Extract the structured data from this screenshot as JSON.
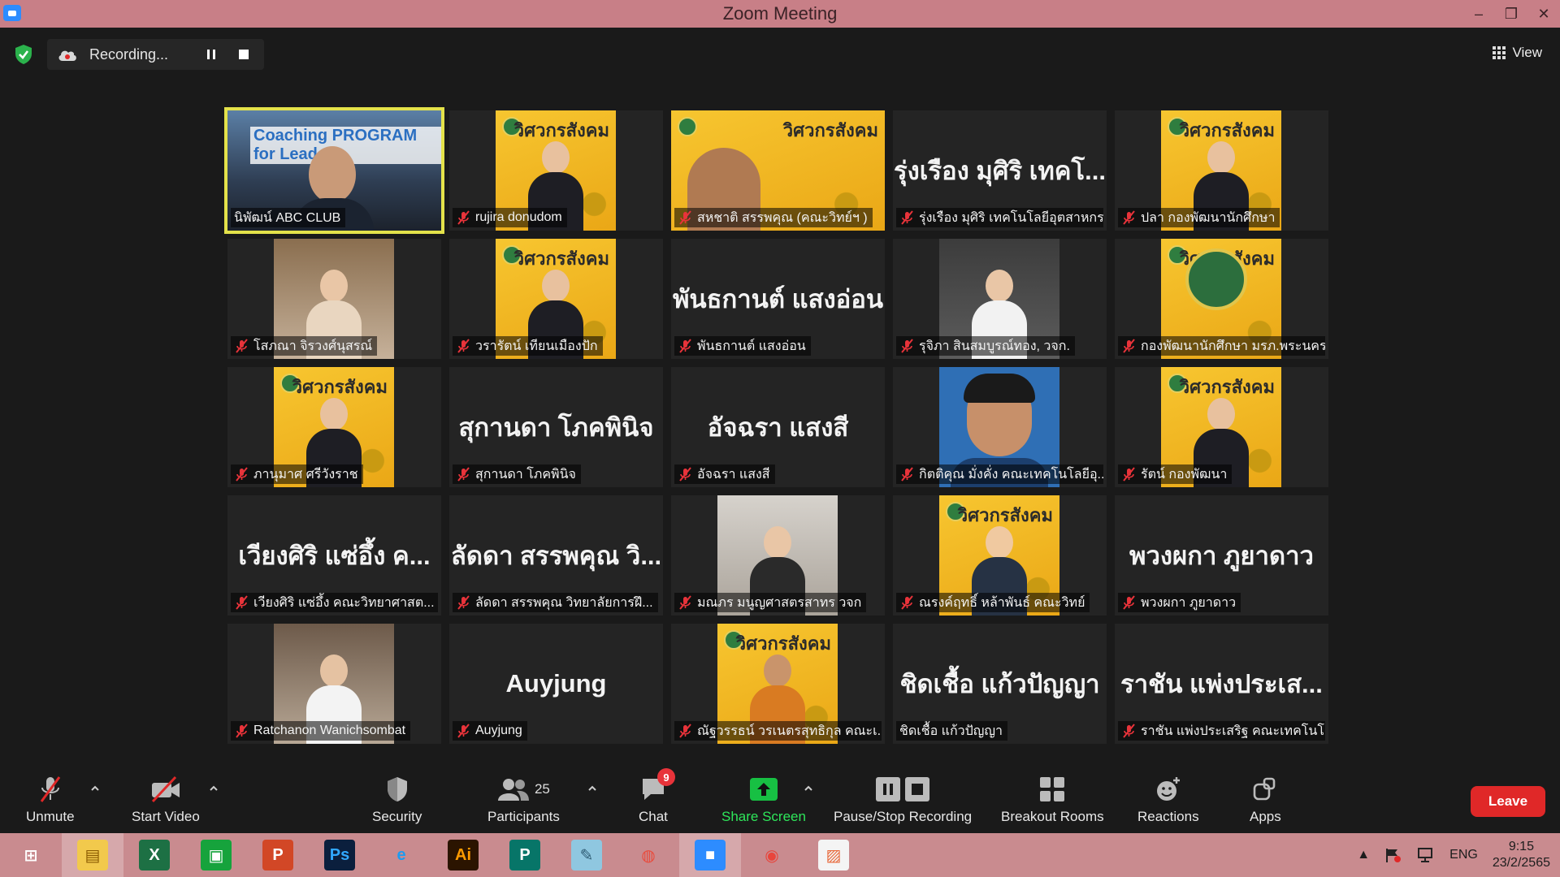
{
  "window": {
    "title": "Zoom Meeting"
  },
  "topbar": {
    "recording_text": "Recording...",
    "view_label": "View"
  },
  "tiles": [
    {
      "name": "นิพัฒน์ ABC CLUB",
      "big": "",
      "muted": false,
      "kind": "video-coaching",
      "overlay": "Coaching PROGRAM for Leader"
    },
    {
      "name": "rujira donudom",
      "big": "",
      "muted": true,
      "kind": "yellow-woman"
    },
    {
      "name": "สหชาติ สรรพคุณ (คณะวิทย์ฯ )",
      "big": "",
      "muted": true,
      "kind": "yellow-wide"
    },
    {
      "name": "รุ่งเรือง มุศิริ เทคโนโลยีอุตสาหกร...",
      "big": "รุ่งเรือง มุศิริ เทคโ...",
      "muted": true,
      "kind": "text"
    },
    {
      "name": "ปลา กองพัฒนานักศึกษา",
      "big": "",
      "muted": true,
      "kind": "yellow-woman"
    },
    {
      "name": "โสภณา จิรวงศ์นุสรณ์",
      "big": "",
      "muted": true,
      "kind": "photo-woman"
    },
    {
      "name": "วรารัตน์ เทียนเมืองปัก",
      "big": "",
      "muted": true,
      "kind": "yellow-woman"
    },
    {
      "name": "พันธกานต์ แสงอ่อน",
      "big": "พันธกานต์ แสงอ่อน",
      "muted": true,
      "kind": "text"
    },
    {
      "name": "รุจิภา สินสมบูรณ์ทอง, วจก.",
      "big": "",
      "muted": true,
      "kind": "photo-girl"
    },
    {
      "name": "กองพัฒนานักศึกษา มรภ.พระนคร",
      "big": "",
      "muted": true,
      "kind": "yellow-logo"
    },
    {
      "name": "ภานุมาศ ศรีวังราช",
      "big": "",
      "muted": true,
      "kind": "yellow-woman"
    },
    {
      "name": "สุกานดา โภคพินิจ",
      "big": "สุกานดา โภคพินิจ",
      "muted": true,
      "kind": "text"
    },
    {
      "name": "อัจฉรา แสงสี",
      "big": "อัจฉรา แสงสี",
      "muted": true,
      "kind": "text"
    },
    {
      "name": "กิตติคุณ มั่งคั่ง คณะเทคโนโลยีอุ...",
      "big": "",
      "muted": true,
      "kind": "cartoon-man"
    },
    {
      "name": "รัตน์ กองพัฒนา",
      "big": "",
      "muted": true,
      "kind": "yellow-woman"
    },
    {
      "name": "เวียงศิริ แซ่อึ้ง คณะวิทยาศาสต...",
      "big": "เวียงศิริ แซ่อึ้ง ค...",
      "muted": true,
      "kind": "text"
    },
    {
      "name": "ลัดดา สรรพคุณ วิทยาลัยการฝึ...",
      "big": "ลัดดา สรรพคุณ วิ...",
      "muted": true,
      "kind": "text"
    },
    {
      "name": "มณภร มนูญศาสตรสาทร วจก",
      "big": "",
      "muted": true,
      "kind": "photo-woman2"
    },
    {
      "name": "ณรงค์ฤทธิ์ หล้าพันธ์ คณะวิทย์",
      "big": "",
      "muted": true,
      "kind": "yellow-cartoon"
    },
    {
      "name": "พวงผกา ภูยาดาว",
      "big": "พวงผกา ภูยาดาว",
      "muted": true,
      "kind": "text"
    },
    {
      "name": "Ratchanon Wanichsombat",
      "big": "",
      "muted": true,
      "kind": "photo-restaurant"
    },
    {
      "name": "Auyjung",
      "big": "Auyjung",
      "muted": true,
      "kind": "text"
    },
    {
      "name": "ณัฐวรรธน์ วรเนตรสุทธิกุล คณะเ...",
      "big": "",
      "muted": true,
      "kind": "yellow-man"
    },
    {
      "name": "ชิดเชื้อ แก้วปัญญา",
      "big": "ชิดเชื้อ แก้วปัญญา",
      "muted": false,
      "kind": "text"
    },
    {
      "name": "ราชัน แพ่งประเสริฐ คณะเทคโนโล...",
      "big": "ราชัน แพ่งประเส...",
      "muted": true,
      "kind": "text"
    }
  ],
  "yellow_title": "วิศวกรสังคม",
  "toolbar": {
    "unmute": "Unmute",
    "start_video": "Start Video",
    "security": "Security",
    "participants": "Participants",
    "participants_count": "25",
    "chat": "Chat",
    "chat_badge": "9",
    "share_screen": "Share Screen",
    "pause_stop": "Pause/Stop Recording",
    "breakout": "Breakout Rooms",
    "reactions": "Reactions",
    "apps": "Apps",
    "leave": "Leave"
  },
  "taskbar": {
    "apps": [
      {
        "icon": "windows-start-icon",
        "open": false
      },
      {
        "icon": "file-explorer-icon",
        "open": true
      },
      {
        "icon": "excel-icon",
        "open": false
      },
      {
        "icon": "store-icon",
        "open": false
      },
      {
        "icon": "powerpoint-icon",
        "open": false
      },
      {
        "icon": "photoshop-icon",
        "open": false
      },
      {
        "icon": "internet-explorer-icon",
        "open": false
      },
      {
        "icon": "illustrator-icon",
        "open": false
      },
      {
        "icon": "publisher-icon",
        "open": false
      },
      {
        "icon": "notepad-icon",
        "open": false
      },
      {
        "icon": "photoscape-icon",
        "open": false
      },
      {
        "icon": "zoom-icon",
        "open": true
      },
      {
        "icon": "chrome-icon",
        "open": false
      },
      {
        "icon": "picture-viewer-icon",
        "open": false
      }
    ],
    "language": "ENG",
    "time": "9:15",
    "date": "23/2/2565"
  },
  "colors": {
    "accent_green": "#2ee65a",
    "leave_red": "#e02828",
    "active_speaker": "#e4e24a",
    "taskbar": "#c98b8f"
  }
}
